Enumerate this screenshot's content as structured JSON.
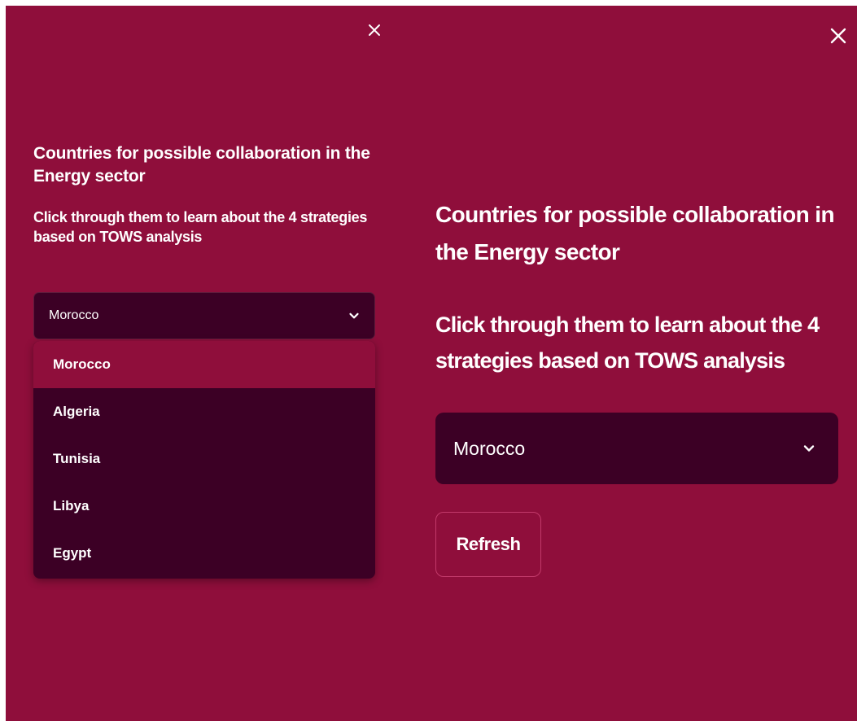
{
  "colors": {
    "background": "#8f0e3b",
    "select_background": "#3c0025",
    "highlight": "#8f0e3b",
    "text": "#ffffff"
  },
  "sidebar": {
    "close_icon": "close-icon",
    "title": "Countries for possible collaboration in the Energy sector",
    "subtitle": "Click through them to learn about the 4 strategies based on TOWS analysis",
    "select": {
      "value": "Morocco",
      "icon": "chevron-down-icon",
      "open": true,
      "options": [
        "Morocco",
        "Algeria",
        "Tunisia",
        "Libya",
        "Egypt"
      ]
    }
  },
  "main": {
    "close_icon": "close-icon",
    "title": "Countries for possible collaboration in the Energy sector",
    "subtitle": "Click through them to learn about the 4 strategies based on TOWS analysis",
    "select": {
      "value": "Morocco",
      "icon": "chevron-down-icon"
    },
    "refresh_label": "Refresh"
  }
}
